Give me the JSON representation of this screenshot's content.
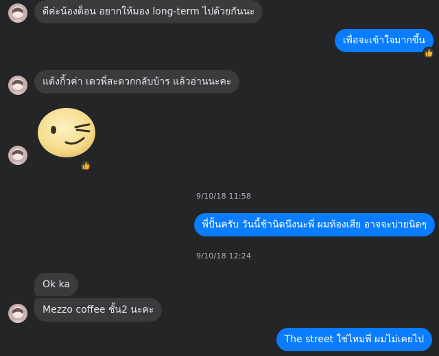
{
  "messages": [
    {
      "text": "ดีค่ะน้องต็อน อยากให้มอง long-term ไปด้วยกันนะ"
    },
    {
      "text": "เพื่อจะเข้าใจมากขึ้น",
      "reaction_icon": "thumbs-up-icon"
    },
    {
      "text": "แต้งกิ้วค่า เดวพี่สะดวกกลับบ้าร แล้วอ่านนะคะ"
    },
    {
      "sticker_icon": "winking-face-sticker",
      "reaction_icon": "thumbs-up-icon"
    },
    {
      "text": "พี่ปั้นครับ วันนี้ช้านิดนึงนะพี่ ผมท้องเสีย อาจจะบ่ายนิดๆ"
    },
    {
      "text": "Ok ka"
    },
    {
      "text": "Mezzo coffee ชั้น2 นะคะ"
    },
    {
      "text": "The street ใช่ไหมพี่ ผมไม่เคยไป"
    }
  ],
  "timestamps": [
    "9/10/18 11:58",
    "9/10/18 12:24"
  ],
  "colors": {
    "background": "#242526",
    "incoming_bubble": "#3a3b3c",
    "outgoing_bubble": "#0a7cff",
    "timestamp_text": "#b0b3b8",
    "reaction_yellow": "#f7b125"
  }
}
